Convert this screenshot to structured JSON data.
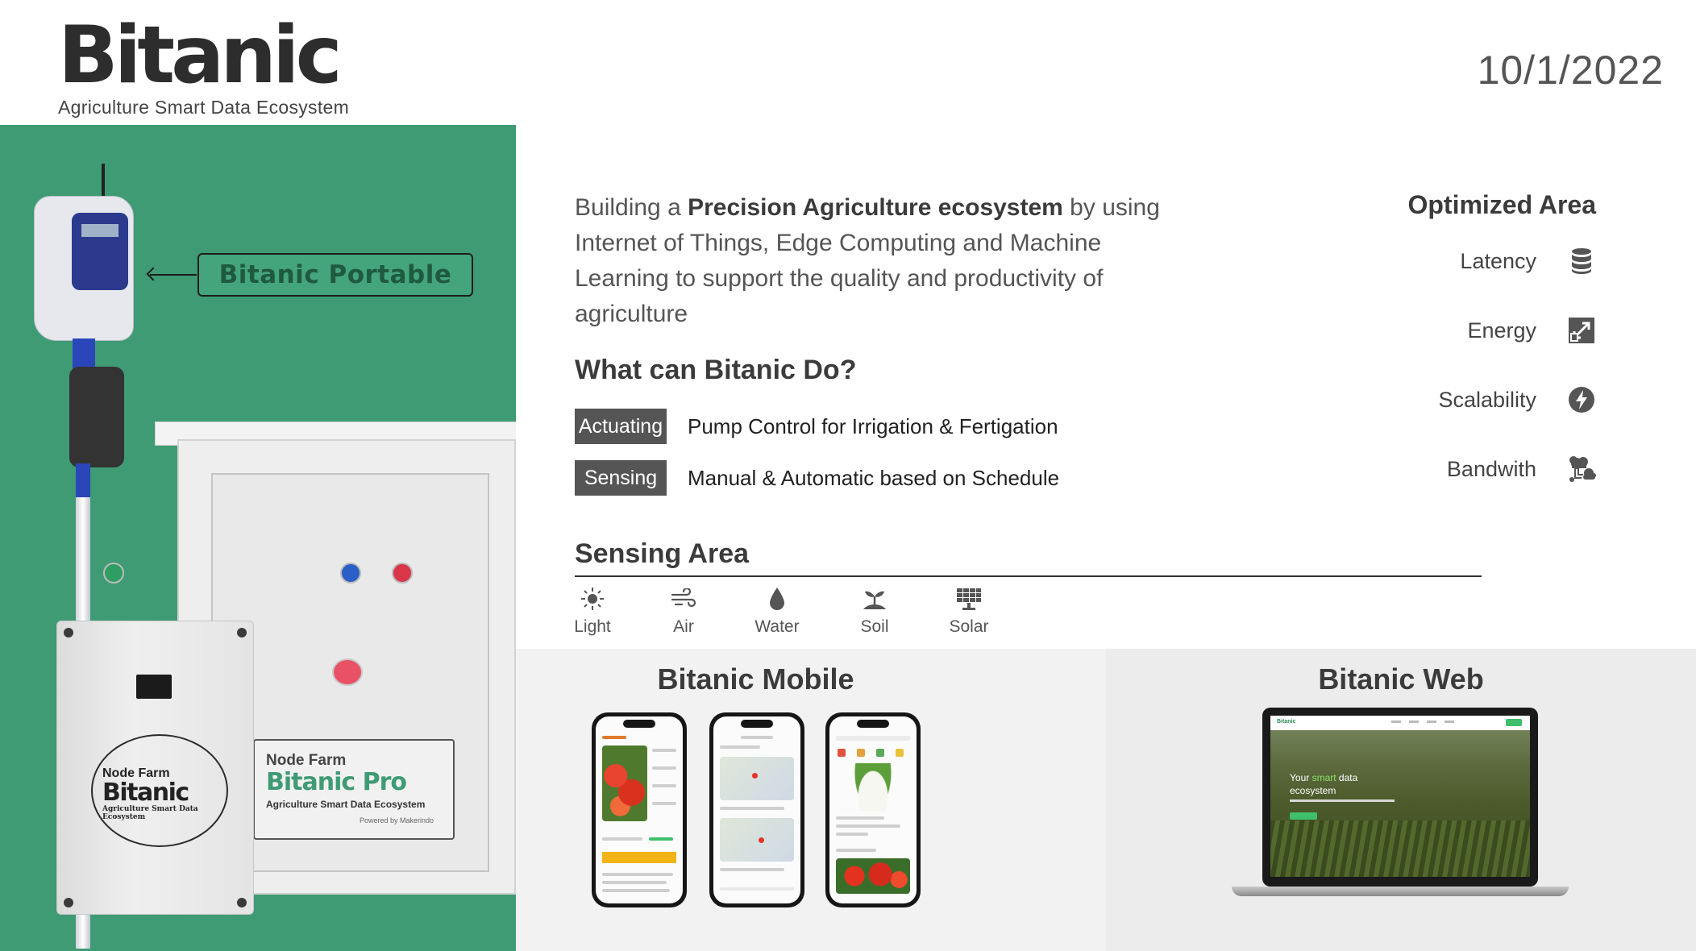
{
  "header": {
    "brand": "Bitanic",
    "tagline": "Agriculture Smart Data Ecosystem",
    "date": "10/1/2022"
  },
  "hardware": {
    "portable_label": "Bitanic Portable",
    "pro_box": {
      "line1": "Node Farm",
      "line2": "Bitanic Pro",
      "line3": "Agriculture Smart Data Ecosystem",
      "line4": "Powered by Makerindo"
    },
    "node_box": {
      "line1": "Node Farm",
      "line2": "Bitanic",
      "line3": "Agriculture Smart Data Ecosystem"
    }
  },
  "intro": {
    "pre": "Building a ",
    "bold": "Precision Agriculture ecosystem",
    "post": " by using Internet of Things, Edge Computing and Machine Learning to support the quality and productivity of agriculture"
  },
  "capabilities": {
    "title": "What can Bitanic Do?",
    "items": [
      {
        "tag": "Actuating",
        "desc": "Pump Control for Irrigation & Fertigation"
      },
      {
        "tag": "Sensing",
        "desc": "Manual & Automatic based on Schedule"
      }
    ]
  },
  "sensing": {
    "title": "Sensing Area",
    "items": [
      {
        "label": "Light",
        "icon": "sun-icon"
      },
      {
        "label": "Air",
        "icon": "wind-icon"
      },
      {
        "label": "Water",
        "icon": "water-drop-icon"
      },
      {
        "label": "Soil",
        "icon": "sprout-soil-icon"
      },
      {
        "label": "Solar",
        "icon": "solar-panel-icon"
      }
    ]
  },
  "optimized": {
    "title": "Optimized Area",
    "items": [
      {
        "label": "Latency",
        "icon": "database-icon"
      },
      {
        "label": "Energy",
        "icon": "resize-arrow-icon"
      },
      {
        "label": "Scalability",
        "icon": "lightning-icon"
      },
      {
        "label": "Bandwith",
        "icon": "cloud-network-icon"
      }
    ]
  },
  "mobile": {
    "title": "Bitanic Mobile"
  },
  "web": {
    "title": "Bitanic Web",
    "hero_prefix": "Your ",
    "hero_accent": "smart",
    "hero_mid": " data",
    "hero_line2": "ecosystem",
    "nav_logo": "Bitanic"
  },
  "colors": {
    "panel_green": "#3f9b74",
    "tag_gray": "#555555",
    "text_dark": "#3b3b3b"
  }
}
